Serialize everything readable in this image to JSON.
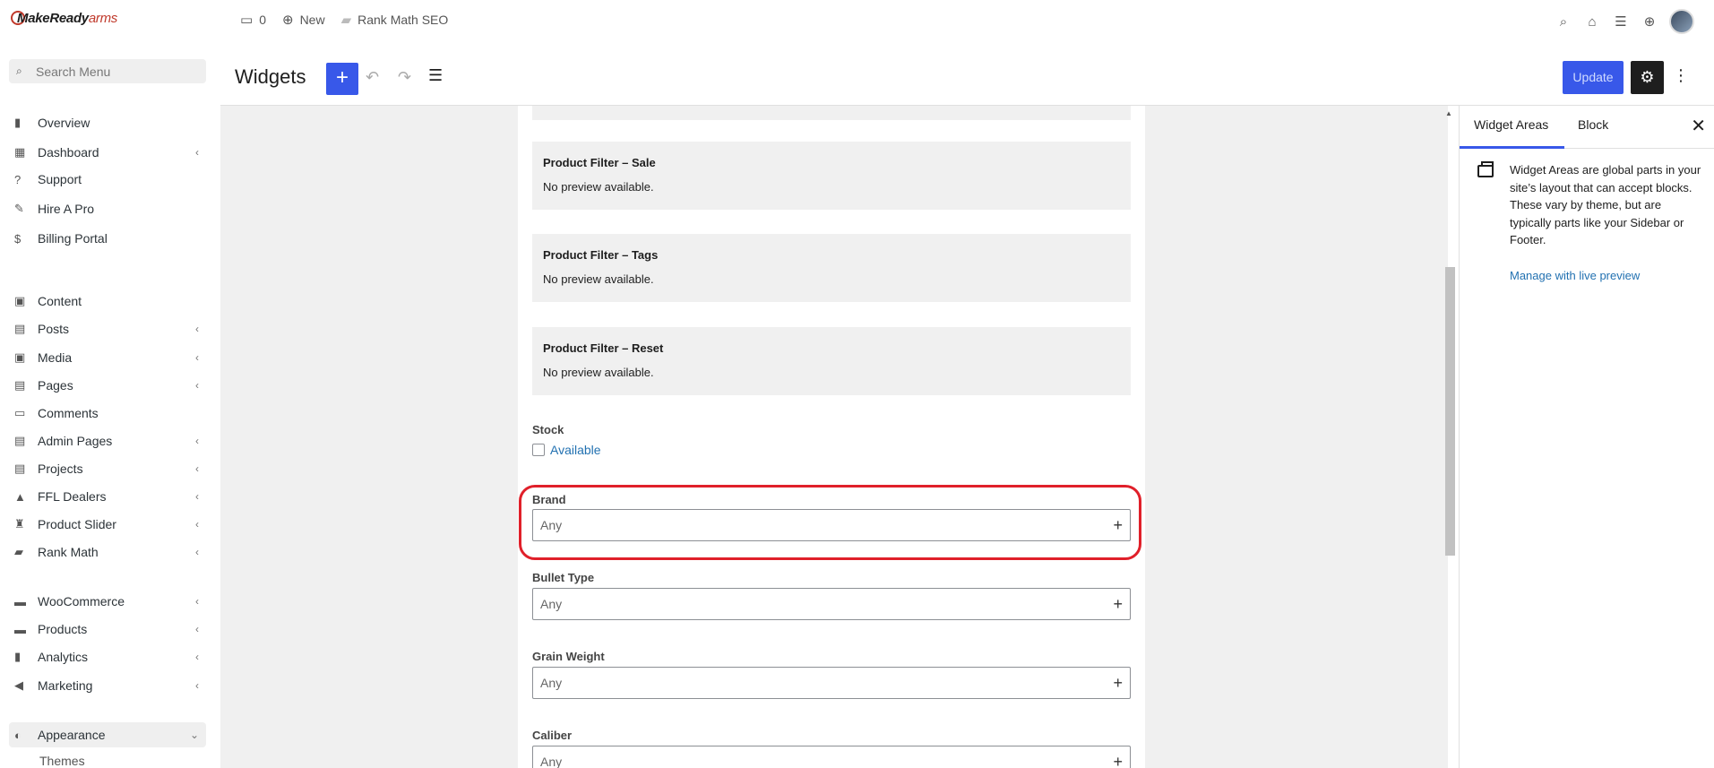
{
  "brand": {
    "logo_main": "MakeReady",
    "logo_accent": "arms"
  },
  "sidebar": {
    "search_placeholder": "Search Menu",
    "items": [
      {
        "label": "Overview",
        "icon": "chart-bar-icon",
        "glyph": "▮",
        "chevron": false
      },
      {
        "label": "Dashboard",
        "icon": "grid-icon",
        "glyph": "▦",
        "chevron": true
      },
      {
        "label": "Support",
        "icon": "help-icon",
        "glyph": "?",
        "chevron": false
      },
      {
        "label": "Hire A Pro",
        "icon": "user-edit-icon",
        "glyph": "✎",
        "chevron": false
      },
      {
        "label": "Billing Portal",
        "icon": "dollar-icon",
        "glyph": "$",
        "chevron": false
      },
      {
        "label": "Content",
        "icon": "image-icon",
        "glyph": "▣",
        "chevron": false
      },
      {
        "label": "Posts",
        "icon": "document-icon",
        "glyph": "▤",
        "chevron": true
      },
      {
        "label": "Media",
        "icon": "media-icon",
        "glyph": "▣",
        "chevron": true
      },
      {
        "label": "Pages",
        "icon": "page-icon",
        "glyph": "▤",
        "chevron": true
      },
      {
        "label": "Comments",
        "icon": "comment-icon",
        "glyph": "▭",
        "chevron": false
      },
      {
        "label": "Admin Pages",
        "icon": "admin-page-icon",
        "glyph": "▤",
        "chevron": true
      },
      {
        "label": "Projects",
        "icon": "project-icon",
        "glyph": "▤",
        "chevron": true
      },
      {
        "label": "FFL Dealers",
        "icon": "dealer-icon",
        "glyph": "▲",
        "chevron": true
      },
      {
        "label": "Product Slider",
        "icon": "slider-icon",
        "glyph": "♜",
        "chevron": true
      },
      {
        "label": "Rank Math",
        "icon": "rank-math-icon",
        "glyph": "▰",
        "chevron": true
      },
      {
        "label": "WooCommerce",
        "icon": "woocommerce-icon",
        "glyph": "▬",
        "chevron": true
      },
      {
        "label": "Products",
        "icon": "box-icon",
        "glyph": "▬",
        "chevron": true
      },
      {
        "label": "Analytics",
        "icon": "analytics-icon",
        "glyph": "▮",
        "chevron": true
      },
      {
        "label": "Marketing",
        "icon": "megaphone-icon",
        "glyph": "◀",
        "chevron": true
      },
      {
        "label": "Appearance",
        "icon": "palette-icon",
        "glyph": "◐",
        "chevron": true,
        "active": true
      }
    ],
    "sub_item": "Themes"
  },
  "topbar": {
    "comments_count": "0",
    "new_label": "New",
    "seo_label": "Rank Math SEO"
  },
  "header": {
    "title": "Widgets",
    "update_label": "Update"
  },
  "content": {
    "previews": [
      {
        "title": "Product Filter – Sale",
        "text": "No preview available."
      },
      {
        "title": "Product Filter – Tags",
        "text": "No preview available."
      },
      {
        "title": "Product Filter – Reset",
        "text": "No preview available."
      }
    ],
    "stock_label": "Stock",
    "stock_option": "Available",
    "filters": [
      {
        "label": "Brand",
        "value": "Any"
      },
      {
        "label": "Bullet Type",
        "value": "Any"
      },
      {
        "label": "Grain Weight",
        "value": "Any"
      },
      {
        "label": "Caliber",
        "value": "Any"
      }
    ]
  },
  "panel": {
    "tabs": [
      "Widget Areas",
      "Block"
    ],
    "description": "Widget Areas are global parts in your site’s layout that can accept blocks. These vary by theme, but are typically parts like your Sidebar or Footer.",
    "link": "Manage with live preview"
  },
  "colors": {
    "accent": "#3858e9",
    "highlight": "#e0202a",
    "link": "#2271b1"
  }
}
